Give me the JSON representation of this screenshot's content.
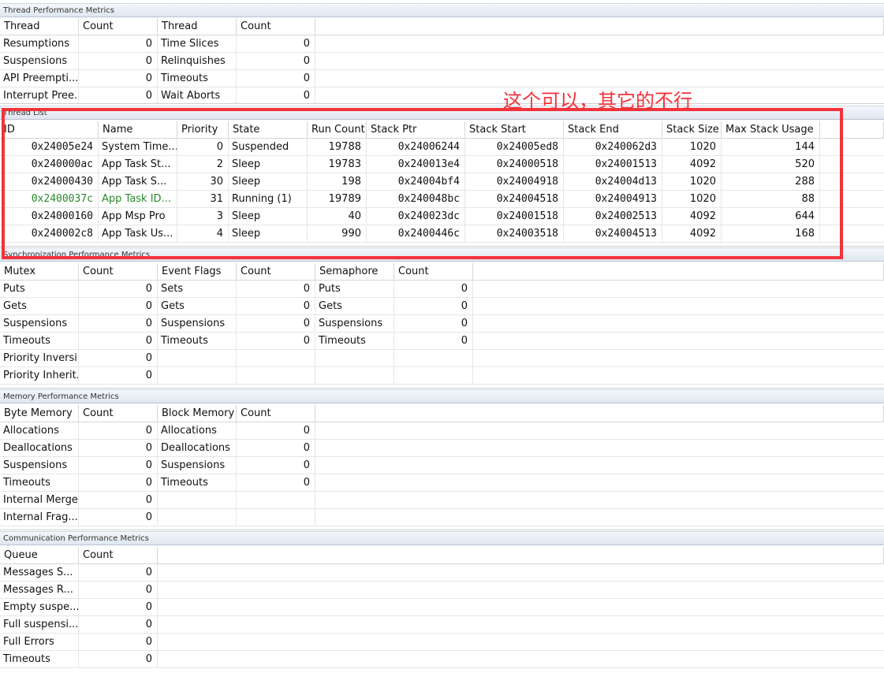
{
  "sections": {
    "thread_perf": "Thread Performance Metrics",
    "thread_list": "Thread List",
    "sync_perf": "Synchronization Performance Metrics",
    "memory_perf": "Memory Performance Metrics",
    "comm_perf": "Communication Performance Metrics"
  },
  "thread_perf": {
    "headers": [
      "Thread",
      "Count",
      "Thread",
      "Count"
    ],
    "rows": [
      [
        "Resumptions",
        "0",
        "Time Slices",
        "0"
      ],
      [
        "Suspensions",
        "0",
        "Relinquishes",
        "0"
      ],
      [
        "API Preempti...",
        "0",
        "Timeouts",
        "0"
      ],
      [
        "Interrupt Pree...",
        "0",
        "Wait Aborts",
        "0"
      ]
    ]
  },
  "thread_list": {
    "headers": [
      "ID",
      "Name",
      "Priority",
      "State",
      "Run Count",
      "Stack Ptr",
      "Stack Start",
      "Stack End",
      "Stack Size",
      "Max Stack Usage"
    ],
    "rows": [
      {
        "id": "0x24005e24",
        "name": "System Time...",
        "priority": "0",
        "state": "Suspended",
        "run_count": "19788",
        "stack_ptr": "0x24006244",
        "stack_start": "0x24005ed8",
        "stack_end": "0x240062d3",
        "stack_size": "1020",
        "max_stack": "144"
      },
      {
        "id": "0x240000ac",
        "name": "App Task St...",
        "priority": "2",
        "state": "Sleep",
        "run_count": "19783",
        "stack_ptr": "0x240013e4",
        "stack_start": "0x24000518",
        "stack_end": "0x24001513",
        "stack_size": "4092",
        "max_stack": "520"
      },
      {
        "id": "0x24000430",
        "name": "App Task S...",
        "priority": "30",
        "state": "Sleep",
        "run_count": "198",
        "stack_ptr": "0x24004bf4",
        "stack_start": "0x24004918",
        "stack_end": "0x24004d13",
        "stack_size": "1020",
        "max_stack": "288"
      },
      {
        "id": "0x2400037c",
        "name": "App Task ID...",
        "priority": "31",
        "state": "Running (1)",
        "run_count": "19789",
        "stack_ptr": "0x240048bc",
        "stack_start": "0x24004518",
        "stack_end": "0x24004913",
        "stack_size": "1020",
        "max_stack": "88"
      },
      {
        "id": "0x24000160",
        "name": "App Msp Pro",
        "priority": "3",
        "state": "Sleep",
        "run_count": "40",
        "stack_ptr": "0x240023dc",
        "stack_start": "0x24001518",
        "stack_end": "0x24002513",
        "stack_size": "4092",
        "max_stack": "644"
      },
      {
        "id": "0x240002c8",
        "name": "App Task Us...",
        "priority": "4",
        "state": "Sleep",
        "run_count": "990",
        "stack_ptr": "0x2400446c",
        "stack_start": "0x24003518",
        "stack_end": "0x24004513",
        "stack_size": "4092",
        "max_stack": "168"
      }
    ],
    "running_color": "#2a8a2a"
  },
  "annotation": {
    "text": "这个可以，其它的不行",
    "color": "#f2333a"
  },
  "sync_perf": {
    "headers": [
      "Mutex",
      "Count",
      "Event Flags",
      "Count",
      "Semaphore",
      "Count"
    ],
    "rows": [
      [
        "Puts",
        "0",
        "Sets",
        "0",
        "Puts",
        "0"
      ],
      [
        "Gets",
        "0",
        "Gets",
        "0",
        "Gets",
        "0"
      ],
      [
        "Suspensions",
        "0",
        "Suspensions",
        "0",
        "Suspensions",
        "0"
      ],
      [
        "Timeouts",
        "0",
        "Timeouts",
        "0",
        "Timeouts",
        "0"
      ],
      [
        "Priority Inversi...",
        "0",
        "",
        "",
        "",
        ""
      ],
      [
        "Priority Inherit...",
        "0",
        "",
        "",
        "",
        ""
      ]
    ]
  },
  "memory_perf": {
    "headers": [
      "Byte Memory",
      "Count",
      "Block Memory",
      "Count"
    ],
    "rows": [
      [
        "Allocations",
        "0",
        "Allocations",
        "0"
      ],
      [
        "Deallocations",
        "0",
        "Deallocations",
        "0"
      ],
      [
        "Suspensions",
        "0",
        "Suspensions",
        "0"
      ],
      [
        "Timeouts",
        "0",
        "Timeouts",
        "0"
      ],
      [
        "Internal Merges",
        "0",
        "",
        ""
      ],
      [
        "Internal Frag...",
        "0",
        "",
        ""
      ]
    ]
  },
  "comm_perf": {
    "headers": [
      "Queue",
      "Count"
    ],
    "rows": [
      [
        "Messages S...",
        "0"
      ],
      [
        "Messages R...",
        "0"
      ],
      [
        "Empty suspe...",
        "0"
      ],
      [
        "Full suspensi...",
        "0"
      ],
      [
        "Full Errors",
        "0"
      ],
      [
        "Timeouts",
        "0"
      ]
    ]
  }
}
